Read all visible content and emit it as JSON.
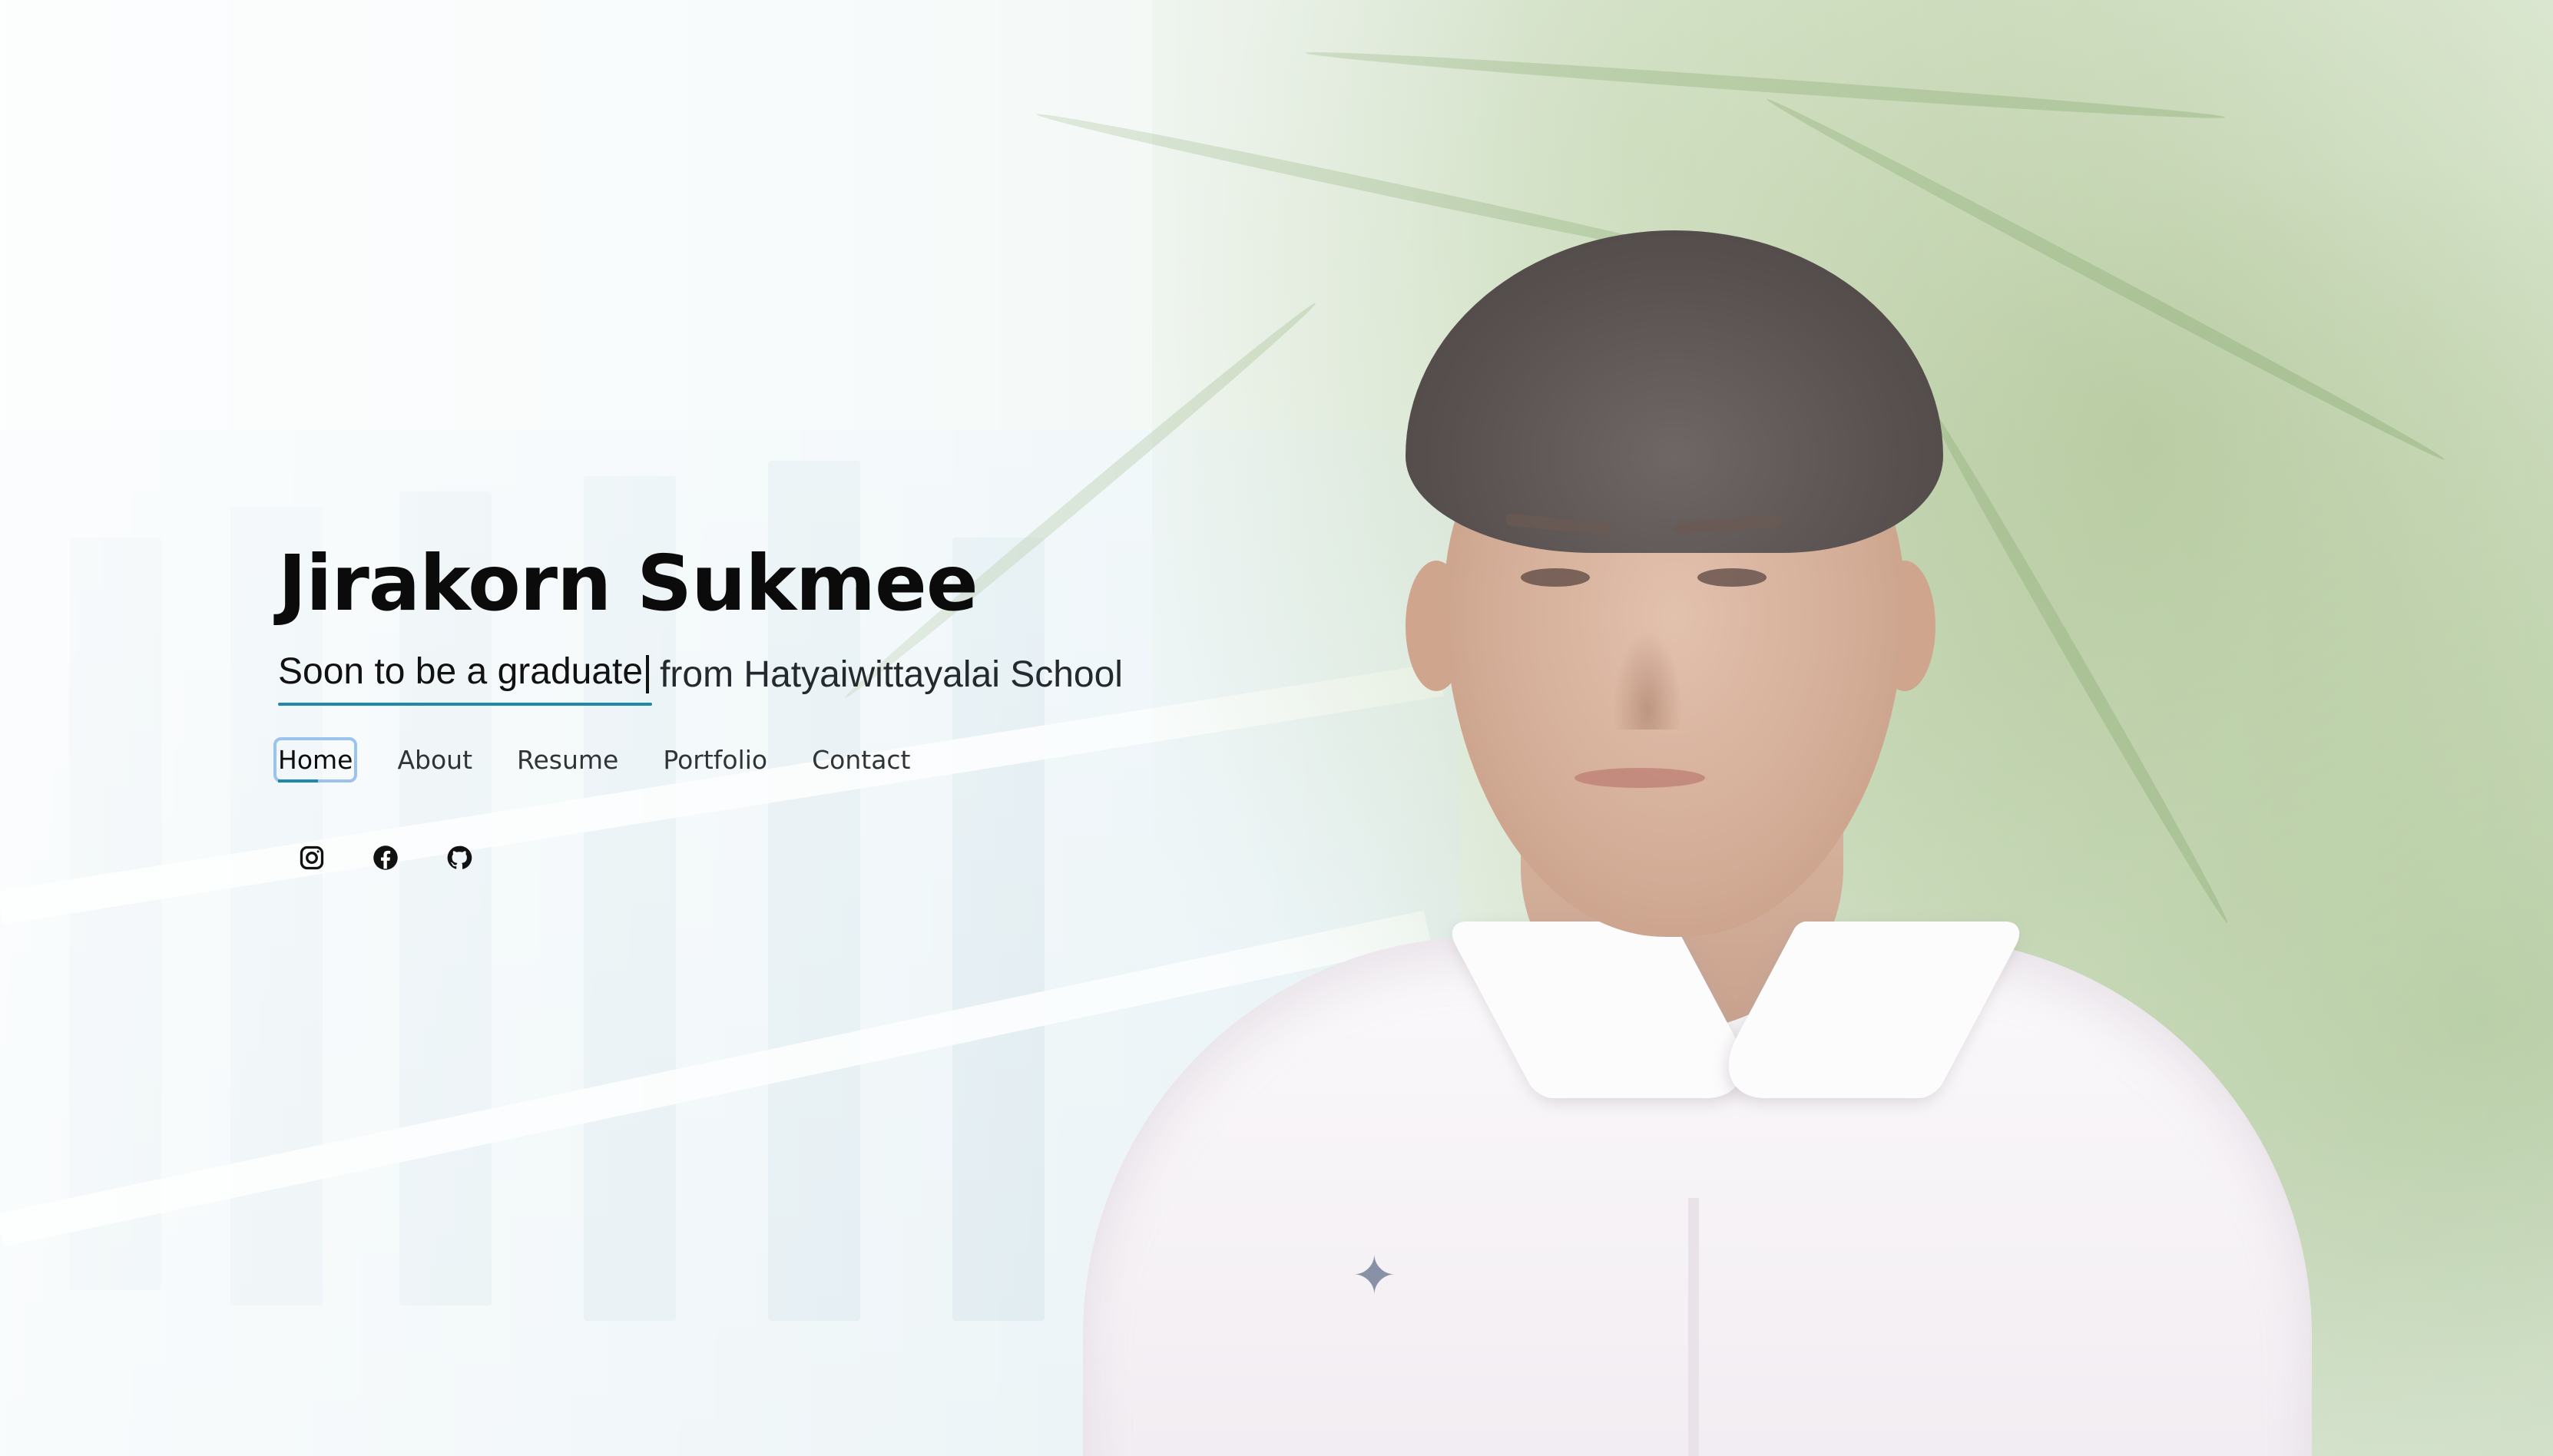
{
  "hero": {
    "name": "Jirakorn Sukmee",
    "typed_text": "Soon to be a graduate",
    "subtitle_rest": "from Hatyaiwittayalai School"
  },
  "nav": {
    "items": [
      {
        "label": "Home",
        "active": true
      },
      {
        "label": "About",
        "active": false
      },
      {
        "label": "Resume",
        "active": false
      },
      {
        "label": "Portfolio",
        "active": false
      },
      {
        "label": "Contact",
        "active": false
      }
    ]
  },
  "socials": [
    {
      "icon": "instagram-icon"
    },
    {
      "icon": "facebook-icon"
    },
    {
      "icon": "github-icon"
    }
  ],
  "colors": {
    "accent": "#1f8aa8",
    "title": "#0b0b0b",
    "focus_outline": "#9cc3ee"
  }
}
